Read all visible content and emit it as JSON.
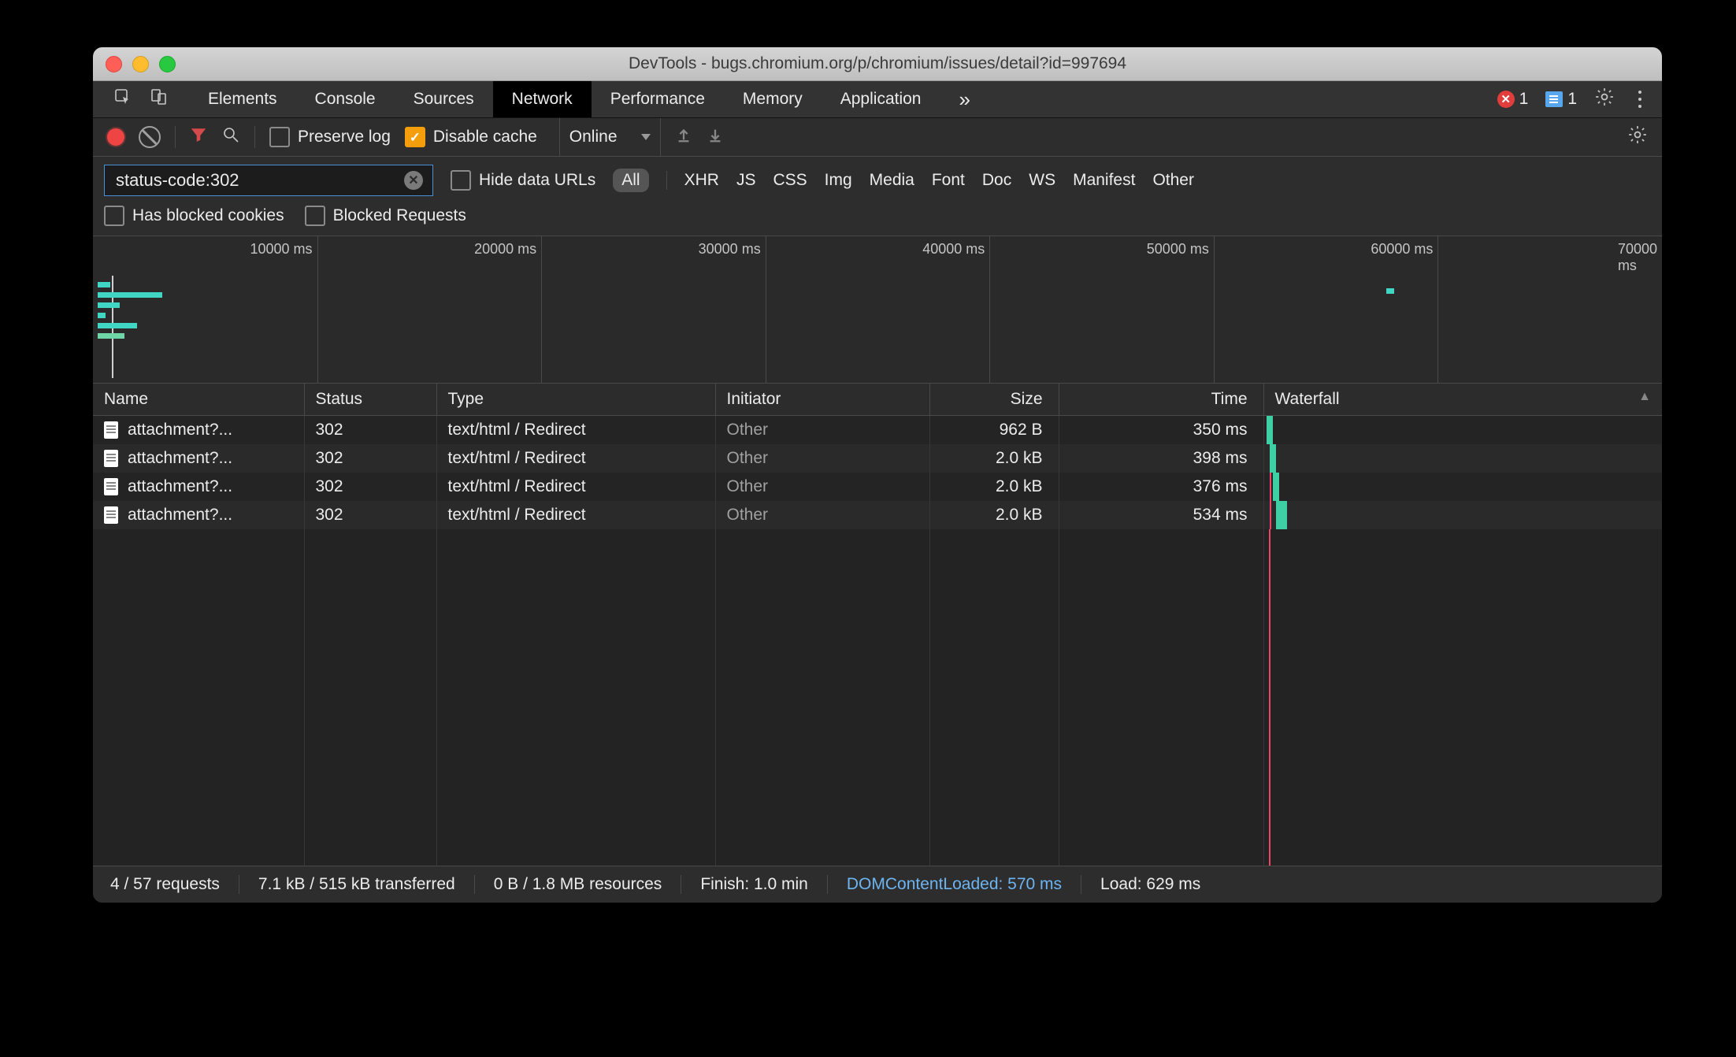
{
  "window": {
    "title": "DevTools - bugs.chromium.org/p/chromium/issues/detail?id=997694"
  },
  "tabs": {
    "items": [
      "Elements",
      "Console",
      "Sources",
      "Network",
      "Performance",
      "Memory",
      "Application"
    ],
    "active": "Network",
    "error_count": "1",
    "message_count": "1",
    "overflow_glyph": "»"
  },
  "net_toolbar": {
    "preserve_log_label": "Preserve log",
    "preserve_log_checked": false,
    "disable_cache_label": "Disable cache",
    "disable_cache_checked": true,
    "throttle_value": "Online"
  },
  "filter": {
    "value": "status-code:302",
    "hide_data_urls_label": "Hide data URLs",
    "hide_data_urls_checked": false,
    "types": [
      "All",
      "XHR",
      "JS",
      "CSS",
      "Img",
      "Media",
      "Font",
      "Doc",
      "WS",
      "Manifest",
      "Other"
    ],
    "active_type": "All",
    "has_blocked_cookies_label": "Has blocked cookies",
    "has_blocked_cookies_checked": false,
    "blocked_requests_label": "Blocked Requests",
    "blocked_requests_checked": false
  },
  "overview": {
    "ticks": [
      "10000 ms",
      "20000 ms",
      "30000 ms",
      "40000 ms",
      "50000 ms",
      "60000 ms",
      "70000 ms"
    ]
  },
  "table": {
    "columns": [
      "Name",
      "Status",
      "Type",
      "Initiator",
      "Size",
      "Time",
      "Waterfall"
    ],
    "sort_column": "Waterfall",
    "rows": [
      {
        "name": "attachment?...",
        "status": "302",
        "type": "text/html / Redirect",
        "initiator": "Other",
        "size": "962 B",
        "time": "350 ms"
      },
      {
        "name": "attachment?...",
        "status": "302",
        "type": "text/html / Redirect",
        "initiator": "Other",
        "size": "2.0 kB",
        "time": "398 ms"
      },
      {
        "name": "attachment?...",
        "status": "302",
        "type": "text/html / Redirect",
        "initiator": "Other",
        "size": "2.0 kB",
        "time": "376 ms"
      },
      {
        "name": "attachment?...",
        "status": "302",
        "type": "text/html / Redirect",
        "initiator": "Other",
        "size": "2.0 kB",
        "time": "534 ms"
      }
    ]
  },
  "statusbar": {
    "requests": "4 / 57 requests",
    "transferred": "7.1 kB / 515 kB transferred",
    "resources": "0 B / 1.8 MB resources",
    "finish": "Finish: 1.0 min",
    "dcl": "DOMContentLoaded: 570 ms",
    "load": "Load: 629 ms"
  }
}
